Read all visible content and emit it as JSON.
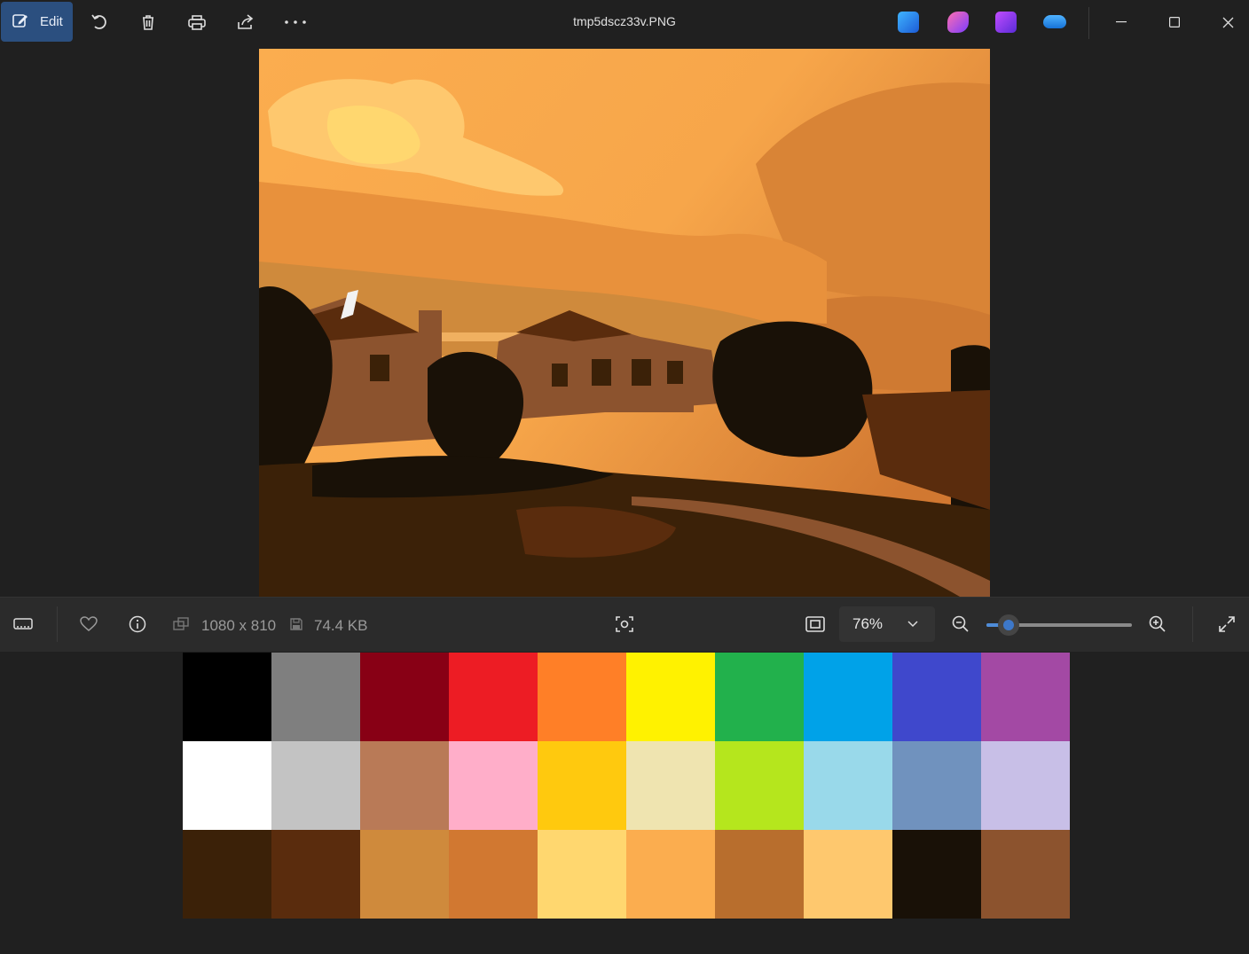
{
  "toolbar": {
    "edit_label": "Edit",
    "file_title": "tmp5dscz33v.PNG"
  },
  "statusbar": {
    "dimensions": "1080 x 810",
    "file_size": "74.4 KB",
    "zoom": "76%",
    "zoom_level": 0.15
  },
  "palette": [
    "#000000",
    "#7f7f7f",
    "#880015",
    "#ed1c24",
    "#ff7f27",
    "#fff200",
    "#22b14c",
    "#00a2e8",
    "#3f48cc",
    "#a349a4",
    "#ffffff",
    "#c3c3c3",
    "#b97a57",
    "#ffaec9",
    "#ffc90e",
    "#efe4b0",
    "#b5e61d",
    "#99d9ea",
    "#7092be",
    "#c8bfe7",
    "#3b2108",
    "#5a2c0d",
    "#cf8a3c",
    "#d17831",
    "#ffd76f",
    "#fbad4f",
    "#b86e2d",
    "#fec86e",
    "#191107",
    "#8c532e"
  ]
}
